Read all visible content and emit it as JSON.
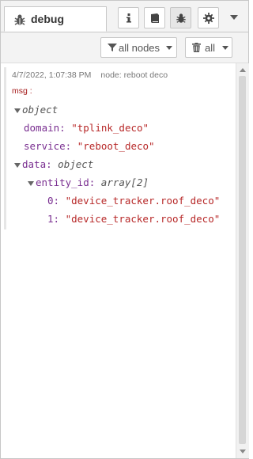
{
  "header": {
    "tab_label": "debug",
    "tab_icon": "bug-icon",
    "buttons": [
      "info-icon",
      "book-icon",
      "bug-icon",
      "gear-icon"
    ],
    "menu_icon": "caret-down-icon"
  },
  "toolbar": {
    "filter_label": "all nodes",
    "clear_label": "all"
  },
  "message": {
    "timestamp": "4/7/2022, 1:07:38 PM",
    "node": "node: reboot deco",
    "topic": "msg :",
    "root_type": "object",
    "domain_key": "domain:",
    "domain_val": "\"tplink_deco\"",
    "service_key": "service:",
    "service_val": "\"reboot_deco\"",
    "data_key": "data:",
    "data_type": "object",
    "entity_key": "entity_id:",
    "entity_type": "array[2]",
    "item0_idx": "0:",
    "item0_val": "\"device_tracker.roof_deco\"",
    "item1_idx": "1:",
    "item1_val": "\"device_tracker.roof_deco\""
  },
  "colors": {
    "key": "#792e90",
    "string": "#b72828",
    "topic": "#a51b1b"
  }
}
